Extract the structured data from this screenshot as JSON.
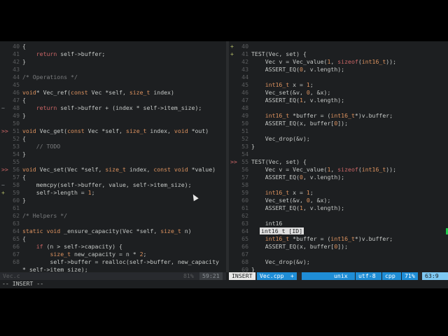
{
  "left": {
    "file_label": "Vec.c",
    "percent": "81%",
    "position": "59:21",
    "lines": [
      {
        "n": "40",
        "sign": "",
        "tokens": [
          [
            "id",
            "{"
          ]
        ]
      },
      {
        "n": "41",
        "sign": "",
        "tokens": [
          [
            "id",
            "    "
          ],
          [
            "kw",
            "return"
          ],
          [
            "id",
            " self->buffer;"
          ]
        ]
      },
      {
        "n": "42",
        "sign": "",
        "tokens": [
          [
            "id",
            "}"
          ]
        ]
      },
      {
        "n": "43",
        "sign": "",
        "tokens": []
      },
      {
        "n": "44",
        "sign": "",
        "tokens": [
          [
            "cm",
            "/* Operations */"
          ]
        ]
      },
      {
        "n": "45",
        "sign": "",
        "tokens": []
      },
      {
        "n": "46",
        "sign": "",
        "tokens": [
          [
            "ty",
            "void"
          ],
          [
            "id",
            "* Vec_ref("
          ],
          [
            "ty",
            "const"
          ],
          [
            "id",
            " Vec *self, "
          ],
          [
            "ty",
            "size_t"
          ],
          [
            "id",
            " index)"
          ]
        ]
      },
      {
        "n": "47",
        "sign": "",
        "tokens": [
          [
            "id",
            "{"
          ]
        ]
      },
      {
        "n": "48",
        "sign": "~",
        "tokens": [
          [
            "id",
            "    "
          ],
          [
            "kw",
            "return"
          ],
          [
            "id",
            " self->buffer + (index * self->item_size);"
          ]
        ]
      },
      {
        "n": "49",
        "sign": "",
        "tokens": [
          [
            "id",
            "}"
          ]
        ]
      },
      {
        "n": "50",
        "sign": "",
        "tokens": []
      },
      {
        "n": "51",
        "sign": ">>",
        "tokens": [
          [
            "ty",
            "void"
          ],
          [
            "id",
            " Vec_get("
          ],
          [
            "ty",
            "const"
          ],
          [
            "id",
            " Vec *self, "
          ],
          [
            "ty",
            "size_t"
          ],
          [
            "id",
            " index, "
          ],
          [
            "ty",
            "void"
          ],
          [
            "id",
            " *out)"
          ]
        ]
      },
      {
        "n": "52",
        "sign": "",
        "tokens": [
          [
            "id",
            "{"
          ]
        ]
      },
      {
        "n": "53",
        "sign": "",
        "tokens": [
          [
            "id",
            "    "
          ],
          [
            "cm",
            "// TODO"
          ]
        ]
      },
      {
        "n": "54",
        "sign": "",
        "tokens": [
          [
            "id",
            "}"
          ]
        ]
      },
      {
        "n": "55",
        "sign": "",
        "tokens": []
      },
      {
        "n": "56",
        "sign": ">>",
        "tokens": [
          [
            "ty",
            "void"
          ],
          [
            "id",
            " Vec_set(Vec *self, "
          ],
          [
            "ty",
            "size_t"
          ],
          [
            "id",
            " index, "
          ],
          [
            "ty",
            "const"
          ],
          [
            "id",
            " "
          ],
          [
            "ty",
            "void"
          ],
          [
            "id",
            " *value)"
          ]
        ]
      },
      {
        "n": "57",
        "sign": "",
        "tokens": [
          [
            "id",
            "{"
          ]
        ]
      },
      {
        "n": "58",
        "sign": "~",
        "tokens": [
          [
            "id",
            "    memcpy(self->buffer, value, self->item_size);"
          ]
        ]
      },
      {
        "n": "59",
        "sign": "+",
        "tokens": [
          [
            "id",
            "    self->length = "
          ],
          [
            "num-lit",
            "1"
          ],
          [
            "id",
            ";"
          ]
        ]
      },
      {
        "n": "60",
        "sign": "",
        "tokens": [
          [
            "id",
            "}"
          ]
        ]
      },
      {
        "n": "61",
        "sign": "",
        "tokens": []
      },
      {
        "n": "62",
        "sign": "",
        "tokens": [
          [
            "cm",
            "/* Helpers */"
          ]
        ]
      },
      {
        "n": "63",
        "sign": "",
        "tokens": []
      },
      {
        "n": "64",
        "sign": "",
        "tokens": [
          [
            "ty",
            "static"
          ],
          [
            "id",
            " "
          ],
          [
            "ty",
            "void"
          ],
          [
            "id",
            " _ensure_capacity(Vec *self, "
          ],
          [
            "ty",
            "size_t"
          ],
          [
            "id",
            " n)"
          ]
        ]
      },
      {
        "n": "65",
        "sign": "",
        "tokens": [
          [
            "id",
            "{"
          ]
        ]
      },
      {
        "n": "66",
        "sign": "",
        "tokens": [
          [
            "id",
            "    "
          ],
          [
            "kw",
            "if"
          ],
          [
            "id",
            " (n > self->capacity) {"
          ]
        ]
      },
      {
        "n": "67",
        "sign": "",
        "tokens": [
          [
            "id",
            "        "
          ],
          [
            "ty",
            "size_t"
          ],
          [
            "id",
            " new_capacity = n * "
          ],
          [
            "num-lit",
            "2"
          ],
          [
            "id",
            ";"
          ]
        ]
      },
      {
        "n": "68",
        "sign": "",
        "tokens": [
          [
            "id",
            "        self->buffer = realloc(self->buffer, new_capacity"
          ]
        ]
      },
      {
        "n": "",
        "sign": "",
        "tokens": [
          [
            "id",
            "* self->item_size);"
          ]
        ]
      }
    ]
  },
  "right": {
    "mode_badge": "INSERT",
    "file_label": "Vec.cpp",
    "modified": "+",
    "format": "unix",
    "encoding": "utf-8",
    "filetype": "cpp",
    "percent": "71%",
    "position": "63:9",
    "lines": [
      {
        "n": "40",
        "sign": "+",
        "tokens": []
      },
      {
        "n": "41",
        "sign": "+",
        "tokens": [
          [
            "id",
            "TEST(Vec, set) {"
          ]
        ]
      },
      {
        "n": "42",
        "sign": "",
        "tokens": [
          [
            "id",
            "    Vec v = Vec_value("
          ],
          [
            "num-lit",
            "1"
          ],
          [
            "id",
            ", "
          ],
          [
            "kw",
            "sizeof"
          ],
          [
            "id",
            "("
          ],
          [
            "ty",
            "int16_t"
          ],
          [
            "id",
            "));"
          ]
        ]
      },
      {
        "n": "43",
        "sign": "",
        "tokens": [
          [
            "id",
            "    ASSERT_EQ("
          ],
          [
            "num-lit",
            "0"
          ],
          [
            "id",
            ", v.length);"
          ]
        ]
      },
      {
        "n": "44",
        "sign": "",
        "tokens": []
      },
      {
        "n": "45",
        "sign": "",
        "tokens": [
          [
            "id",
            "    "
          ],
          [
            "ty",
            "int16_t"
          ],
          [
            "id",
            " x = "
          ],
          [
            "num-lit",
            "1"
          ],
          [
            "id",
            ";"
          ]
        ]
      },
      {
        "n": "46",
        "sign": "",
        "tokens": [
          [
            "id",
            "    Vec_set(&v, "
          ],
          [
            "num-lit",
            "0"
          ],
          [
            "id",
            ", &x);"
          ]
        ]
      },
      {
        "n": "47",
        "sign": "",
        "tokens": [
          [
            "id",
            "    ASSERT_EQ("
          ],
          [
            "num-lit",
            "1"
          ],
          [
            "id",
            ", v.length);"
          ]
        ]
      },
      {
        "n": "48",
        "sign": "",
        "tokens": []
      },
      {
        "n": "49",
        "sign": "",
        "tokens": [
          [
            "id",
            "    "
          ],
          [
            "ty",
            "int16_t"
          ],
          [
            "id",
            " *buffer = ("
          ],
          [
            "ty",
            "int16_t"
          ],
          [
            "id",
            "*)v.buffer;"
          ]
        ]
      },
      {
        "n": "50",
        "sign": "",
        "tokens": [
          [
            "id",
            "    ASSERT_EQ(x, buffer["
          ],
          [
            "num-lit",
            "0"
          ],
          [
            "id",
            "]);"
          ]
        ]
      },
      {
        "n": "51",
        "sign": "",
        "tokens": []
      },
      {
        "n": "52",
        "sign": "",
        "tokens": [
          [
            "id",
            "    Vec_drop(&v);"
          ]
        ]
      },
      {
        "n": "53",
        "sign": "",
        "tokens": [
          [
            "id",
            "}"
          ]
        ]
      },
      {
        "n": "54",
        "sign": "",
        "tokens": []
      },
      {
        "n": "55",
        "sign": ">>",
        "tokens": [
          [
            "id",
            "TEST(Vec, set) {"
          ]
        ]
      },
      {
        "n": "56",
        "sign": "",
        "tokens": [
          [
            "id",
            "    Vec v = Vec_value("
          ],
          [
            "num-lit",
            "1"
          ],
          [
            "id",
            ", "
          ],
          [
            "kw",
            "sizeof"
          ],
          [
            "id",
            "("
          ],
          [
            "ty",
            "int16_t"
          ],
          [
            "id",
            "));"
          ]
        ]
      },
      {
        "n": "57",
        "sign": "",
        "tokens": [
          [
            "id",
            "    ASSERT_EQ("
          ],
          [
            "num-lit",
            "0"
          ],
          [
            "id",
            ", v.length);"
          ]
        ]
      },
      {
        "n": "58",
        "sign": "",
        "tokens": []
      },
      {
        "n": "59",
        "sign": "",
        "tokens": [
          [
            "id",
            "    "
          ],
          [
            "ty",
            "int16_t"
          ],
          [
            "id",
            " x = "
          ],
          [
            "num-lit",
            "1"
          ],
          [
            "id",
            ";"
          ]
        ]
      },
      {
        "n": "60",
        "sign": "",
        "tokens": [
          [
            "id",
            "    Vec_set(&v, "
          ],
          [
            "num-lit",
            "0"
          ],
          [
            "id",
            ", &x);"
          ]
        ]
      },
      {
        "n": "61",
        "sign": "",
        "tokens": [
          [
            "id",
            "    ASSERT_EQ("
          ],
          [
            "num-lit",
            "1"
          ],
          [
            "id",
            ", v.length);"
          ]
        ]
      },
      {
        "n": "62",
        "sign": "",
        "tokens": []
      },
      {
        "n": "63",
        "sign": "",
        "tokens": [
          [
            "id",
            "    int16"
          ]
        ]
      },
      {
        "n": "64",
        "sign": "",
        "popup": "int16_t [ID]",
        "tokens": []
      },
      {
        "n": "65",
        "sign": "",
        "tokens": [
          [
            "id",
            "    "
          ],
          [
            "ty",
            "int16_t"
          ],
          [
            "id",
            " *buffer = ("
          ],
          [
            "ty",
            "int16_t"
          ],
          [
            "id",
            "*)v.buffer;"
          ]
        ]
      },
      {
        "n": "66",
        "sign": "",
        "tokens": [
          [
            "id",
            "    ASSERT_EQ(x, buffer["
          ],
          [
            "num-lit",
            "0"
          ],
          [
            "id",
            "]);"
          ]
        ]
      },
      {
        "n": "67",
        "sign": "",
        "tokens": []
      },
      {
        "n": "68",
        "sign": "",
        "tokens": [
          [
            "id",
            "    Vec_drop(&v);"
          ]
        ]
      },
      {
        "n": "69",
        "sign": "",
        "tokens": [
          [
            "id",
            "}"
          ]
        ]
      }
    ]
  },
  "mode_line": "-- INSERT --",
  "colors": {
    "accent_blue": "#1f8dd6",
    "add_green": "#b5bd68",
    "change_red": "#cc6666",
    "diag_green": "#1fc84a"
  }
}
